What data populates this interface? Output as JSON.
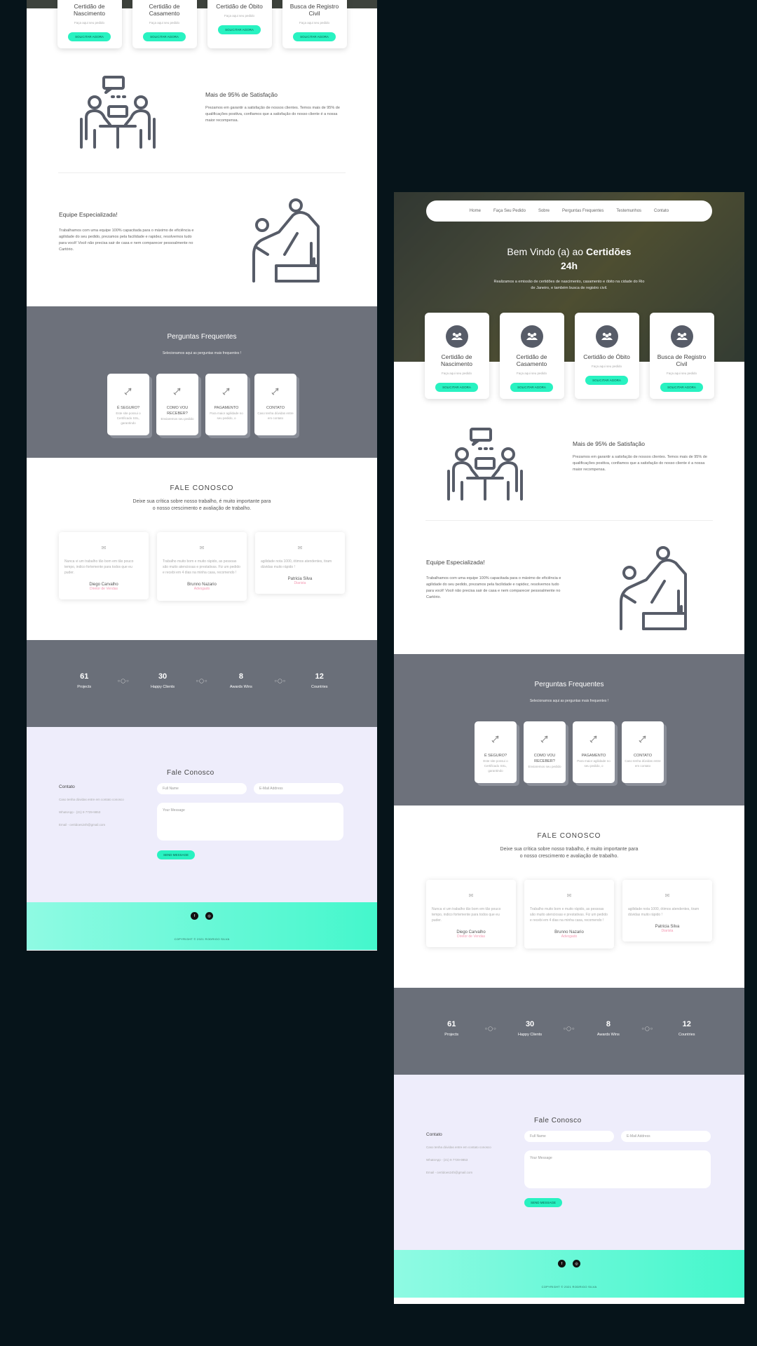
{
  "nav": [
    "Home",
    "Faça Seu Pedido",
    "Sobre",
    "Perguntas Frequentes",
    "Testemunhos",
    "Contato"
  ],
  "hero": {
    "title_plain": "Bem Vindo (a) ao ",
    "title_bold1": "Certidões",
    "title_bold2": "24h",
    "text": "Realizamos a emissão de certidões de nascimento, casamento e óbito na cidade do Rio de Janeiro, e também busca de registro civil."
  },
  "services": [
    {
      "title": "Certidão de Nascimento",
      "sub": "Faça aqui seu pedido",
      "btn": "SOLICITAR AGORA",
      "icon": "people-icon"
    },
    {
      "title": "Certidão de Casamento",
      "sub": "Faça aqui seu pedido",
      "btn": "SOLICITAR AGORA",
      "icon": "people-icon"
    },
    {
      "title": "Certidão de Óbito",
      "sub": "Faça aqui seu pedido",
      "btn": "SOLICITAR AGORA",
      "icon": "people-icon"
    },
    {
      "title": "Busca de Registro Civil",
      "sub": "Faça aqui seu pedido",
      "btn": "SOLICITAR AGORA",
      "icon": "people-icon"
    }
  ],
  "features": {
    "satisfaction": {
      "title": "Mais de 95% de Satisfação",
      "text": "Prezamos em garantir a satisfação de nossos clientes. Temos mais de 95% de qualificações positiva, confiamos que a satisfação do nosso cliente é a nossa maior recompensa."
    },
    "team": {
      "title": "Equipe Especializada!",
      "text": "Trabalhamos com uma equipe 100% capacitada para o máximo de eficiência e agilidade do seu pedido, prezamos pela facilidade e rapidez, resolvemos tudo para você! Você não precisa sair de casa e nem comparecer pessoalmente no Cartório."
    }
  },
  "faq": {
    "title": "Perguntas Frequentes",
    "sub": "Selecionamos aqui as perguntas mais frequentes !",
    "items": [
      {
        "title": "É SEGURO?",
        "text": "Este site possui o Certificado SSL, garantindo"
      },
      {
        "title": "COMO VOU RECEBER?",
        "text": "Enviaremos seu pedido"
      },
      {
        "title": "PAGAMENTO",
        "text": "Para maior agilidade no seu pedido, o"
      },
      {
        "title": "CONTATO",
        "text": "Caso tenha dúvidas entre em contato"
      }
    ]
  },
  "testimonials": {
    "title": "FALE CONOSCO",
    "lead": "Deixe sua crítica sobre nosso trabalho, é muito importante para o nosso crescimento e avaliação de trabalho.",
    "items": [
      {
        "quote": "Nunca vi um trabalho tão bom em tão pouco tempo, indico fortemente para todos que eu puder.",
        "name": "Diego Carvalho",
        "role": "Diretor de Vendas"
      },
      {
        "quote": "Trabalho muito bom e muito rápido, as pessoas são muito atenciosas e prestativas. Fiz um pedido e recebi em 4 dias na minha casa, recomendo !",
        "name": "Brunno Nazario",
        "role": "Advogado"
      },
      {
        "quote": "agilidade nota 1000, ótimos atendentes, tiram dúvidas muito rápido !",
        "name": "Patricia Silva",
        "role": "Diarista"
      }
    ]
  },
  "stats": [
    {
      "value": "61",
      "label": "Projects"
    },
    {
      "value": "30",
      "label": "Happy Clients"
    },
    {
      "value": "8",
      "label": "Awards Wins"
    },
    {
      "value": "12",
      "label": "Countries"
    }
  ],
  "contact": {
    "title": "Fale Conosco",
    "info_title": "Contato",
    "info_1": "Caso tenha dúvidas entre em contato conosco",
    "info_2": "WhatsApp - (21) 9 7729-9853",
    "info_3": "Email - certidoes24h@gmail.com",
    "name_ph": "Full Name",
    "email_ph": "E-Mail Address",
    "msg_ph": "Your Message",
    "send": "SEND MESSAGE"
  },
  "footer": {
    "copyright": "COPYRIGHT © 2021 RODRIGO SILVA"
  },
  "colors": {
    "accent": "#28f2c1",
    "dark": "#575c68",
    "pink": "#f49ab3"
  }
}
